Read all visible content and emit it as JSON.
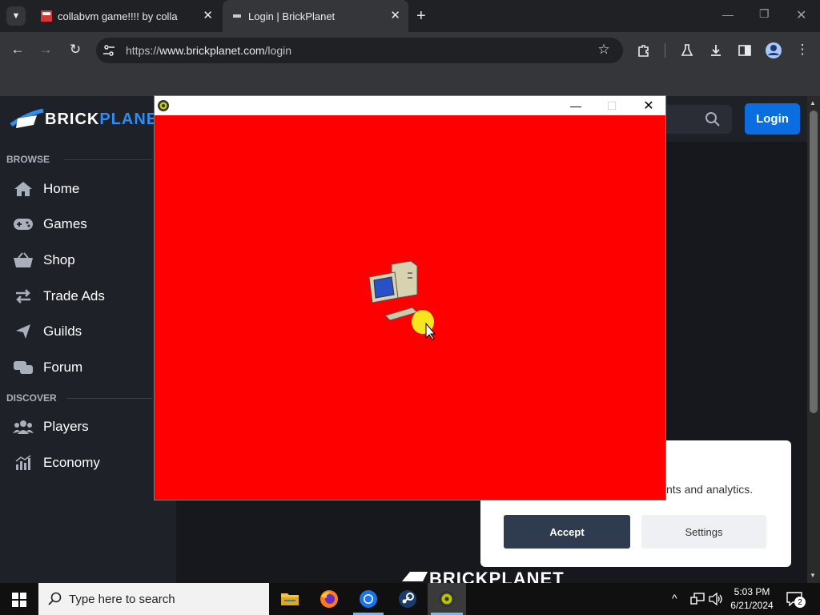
{
  "browser": {
    "tabs": [
      {
        "label": "collabvm game!!!! by collabgame"
      },
      {
        "label": "Login | BrickPlanet"
      }
    ],
    "url_prefix": "https://",
    "url_host": "www.brickplanet.com",
    "url_path": "/login"
  },
  "site": {
    "logo_brick": "BRICK",
    "logo_planet": "PLANET",
    "login_label": "Login",
    "sections": [
      {
        "title": "BROWSE"
      },
      {
        "title": "DISCOVER"
      }
    ],
    "nav": [
      {
        "label": "Home",
        "icon": "home-icon"
      },
      {
        "label": "Games",
        "icon": "gamepad-icon"
      },
      {
        "label": "Shop",
        "icon": "basket-icon"
      },
      {
        "label": "Trade Ads",
        "icon": "swap-icon"
      },
      {
        "label": "Guilds",
        "icon": "flag-icon"
      },
      {
        "label": "Forum",
        "icon": "comments-icon"
      },
      {
        "label": "Players",
        "icon": "users-icon"
      },
      {
        "label": "Economy",
        "icon": "chart-icon"
      }
    ]
  },
  "cookie": {
    "text_visible": "nts and analytics.",
    "accept_label": "Accept",
    "settings_label": "Settings"
  },
  "overlay_window": {
    "background": "#ff0000"
  },
  "taskbar": {
    "search_placeholder": "Type here to search",
    "time": "5:03 PM",
    "date": "6/21/2024",
    "notification_count": "2"
  },
  "colors": {
    "accent": "#0a6ee1",
    "brand_blue": "#2f8cf3"
  }
}
